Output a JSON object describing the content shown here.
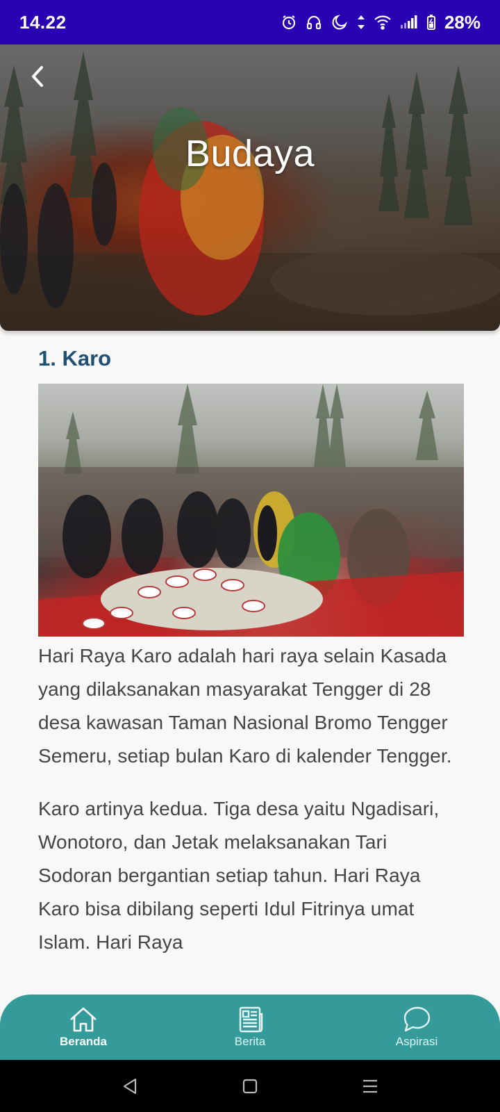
{
  "status_bar": {
    "time": "14.22",
    "battery": "28%",
    "icons": [
      "alarm-icon",
      "headphones-icon",
      "moon-icon",
      "data-arrows-icon",
      "wifi-icon",
      "signal-icon",
      "battery-icon"
    ]
  },
  "header": {
    "title": "Budaya",
    "back_icon": "chevron-left-icon"
  },
  "section": {
    "title": "1. Karo",
    "paragraphs": [
      "Hari Raya Karo adalah hari raya selain Kasada yang dilaksanakan masyarakat Tengger di 28 desa kawasan Taman Nasional Bromo Tengger Semeru, setiap bulan Karo di kalender Tengger.",
      "Karo artinya kedua. Tiga desa yaitu Ngadisari, Wonotoro, dan Jetak melaksanakan Tari Sodoran bergantian setiap tahun. Hari Raya Karo bisa dibilang seperti Idul Fitrinya umat Islam. Hari Raya"
    ]
  },
  "bottom_nav": {
    "items": [
      {
        "label": "Beranda",
        "icon": "home-icon",
        "active": true
      },
      {
        "label": "Berita",
        "icon": "news-icon",
        "active": false
      },
      {
        "label": "Aspirasi",
        "icon": "chat-bubble-icon",
        "active": false
      }
    ]
  },
  "colors": {
    "status_bar": "#2a00b3",
    "section_title": "#1f4f74",
    "bottom_nav": "#349b9a"
  }
}
